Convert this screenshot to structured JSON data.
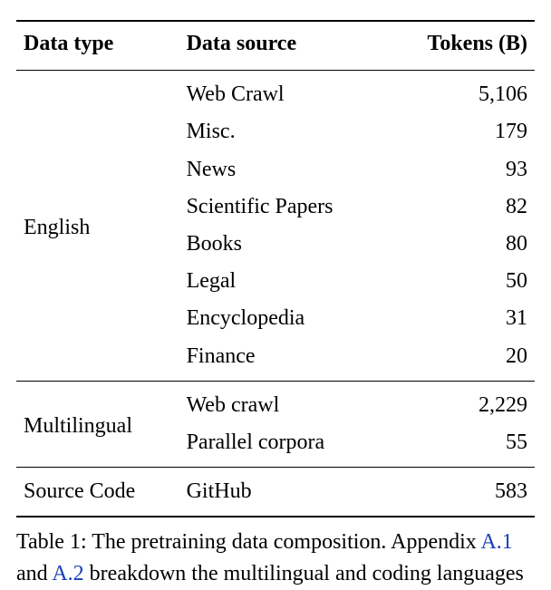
{
  "table": {
    "headers": {
      "type": "Data type",
      "source": "Data source",
      "tokens": "Tokens (B)"
    },
    "groups": [
      {
        "type": "English",
        "rows": [
          {
            "source": "Web Crawl",
            "tokens": "5,106"
          },
          {
            "source": "Misc.",
            "tokens": "179"
          },
          {
            "source": "News",
            "tokens": "93"
          },
          {
            "source": "Scientific Papers",
            "tokens": "82"
          },
          {
            "source": "Books",
            "tokens": "80"
          },
          {
            "source": "Legal",
            "tokens": "50"
          },
          {
            "source": "Encyclopedia",
            "tokens": "31"
          },
          {
            "source": "Finance",
            "tokens": "20"
          }
        ]
      },
      {
        "type": "Multilingual",
        "rows": [
          {
            "source": "Web crawl",
            "tokens": "2,229"
          },
          {
            "source": "Parallel corpora",
            "tokens": "55"
          }
        ]
      },
      {
        "type": "Source Code",
        "rows": [
          {
            "source": "GitHub",
            "tokens": "583"
          }
        ]
      }
    ]
  },
  "caption": {
    "label": "Table 1:",
    "pre": " The pretraining data composition. Appendix ",
    "link1": "A.1",
    "mid": " and ",
    "link2": "A.2",
    "post": " breakdown the multilingual and coding languages"
  }
}
